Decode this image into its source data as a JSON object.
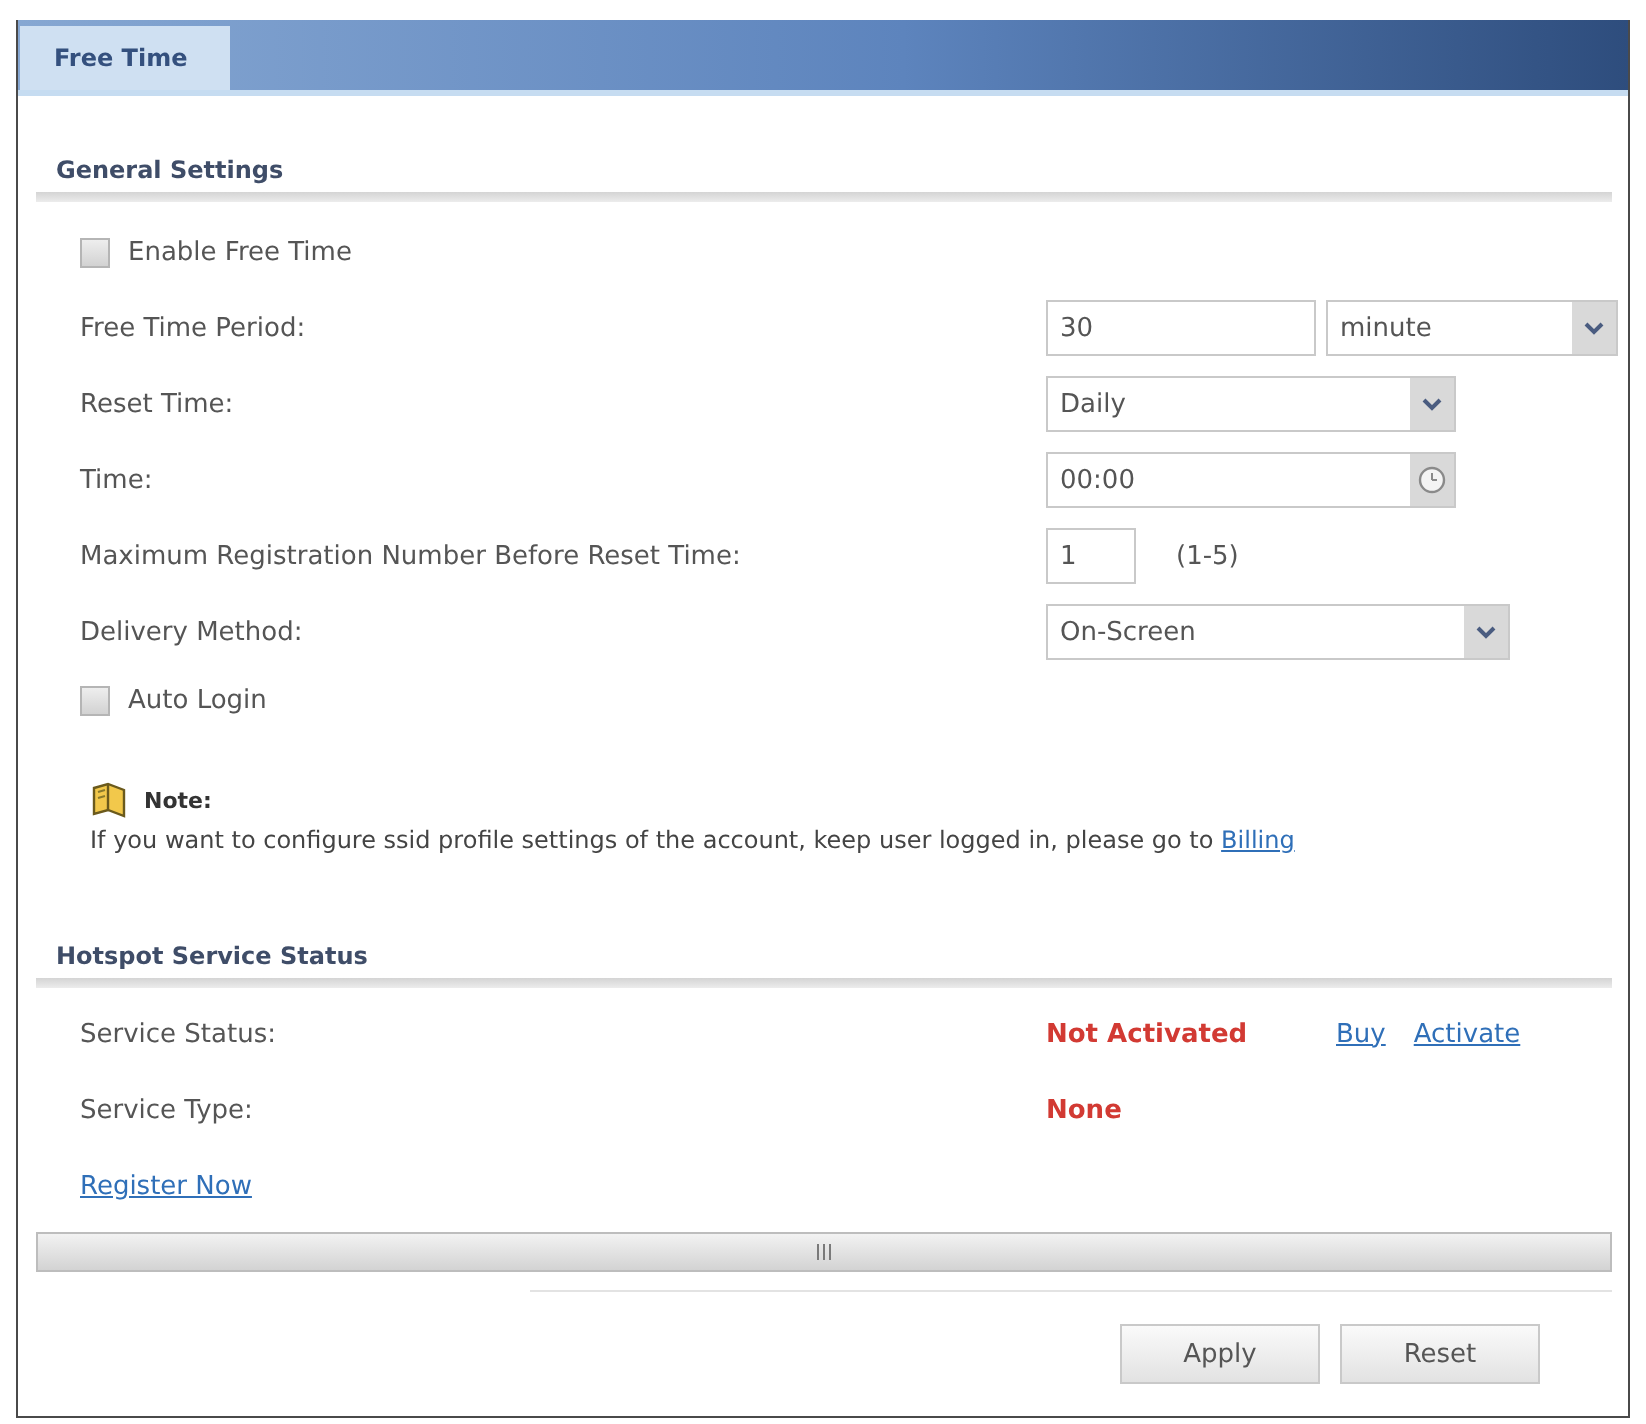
{
  "tabs": [
    {
      "label": "Free Time",
      "selected": true
    }
  ],
  "general_settings": {
    "title": "General Settings",
    "rows": [
      {
        "kind": "checkbox",
        "label": "Enable Free Time",
        "checked": false
      },
      {
        "kind": "period",
        "label": "Free Time Period:",
        "value": "30",
        "unit": "minute"
      },
      {
        "kind": "select",
        "label": "Reset Time:",
        "value": "Daily"
      },
      {
        "kind": "time",
        "label": "Time:",
        "value": "00:00"
      },
      {
        "kind": "number",
        "label": "Maximum Registration Number Before Reset Time:",
        "value": "1",
        "hint": "(1-5)"
      },
      {
        "kind": "select",
        "label": "Delivery Method:",
        "value": "On-Screen"
      },
      {
        "kind": "checkbox",
        "label": "Auto Login",
        "checked": false
      }
    ]
  },
  "note": {
    "title": "Note:",
    "text": "If you want to configure ssid profile settings of the account, keep user logged in, please go to",
    "link": "Billing"
  },
  "hotspot_service_status": {
    "title": "Hotspot Service Status",
    "rows": [
      {
        "label": "Service Status:",
        "value": "Not Activated",
        "links": [
          "Buy",
          "Activate"
        ]
      },
      {
        "label": "Service Type:",
        "value": "None"
      }
    ],
    "register_link": "Register Now"
  },
  "buttons": [
    "Apply",
    "Reset"
  ]
}
